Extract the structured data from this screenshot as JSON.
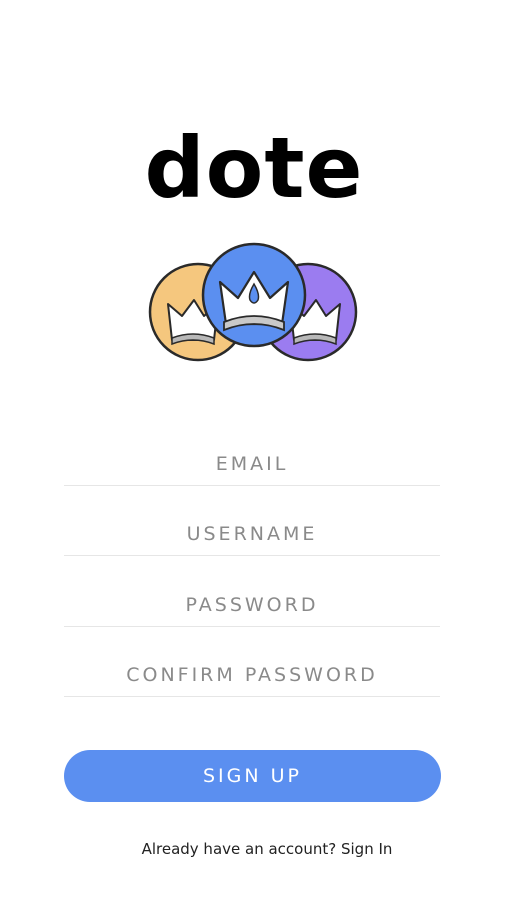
{
  "app": {
    "logo_text": "dote"
  },
  "form": {
    "email_placeholder": "EMAIL",
    "username_placeholder": "USERNAME",
    "password_placeholder": "PASSWORD",
    "confirm_password_placeholder": "CONFIRM PASSWORD",
    "signup_label": "SIGN UP"
  },
  "footer": {
    "prompt": "Already have an account?",
    "signin_label": "Sign In"
  },
  "colors": {
    "accent": "#5b8ff0",
    "crown_orange": "#f5c77e",
    "crown_blue": "#5b8ff0",
    "crown_purple": "#9b7cf0"
  },
  "icons": {
    "logo": "crowns-logo-icon"
  }
}
